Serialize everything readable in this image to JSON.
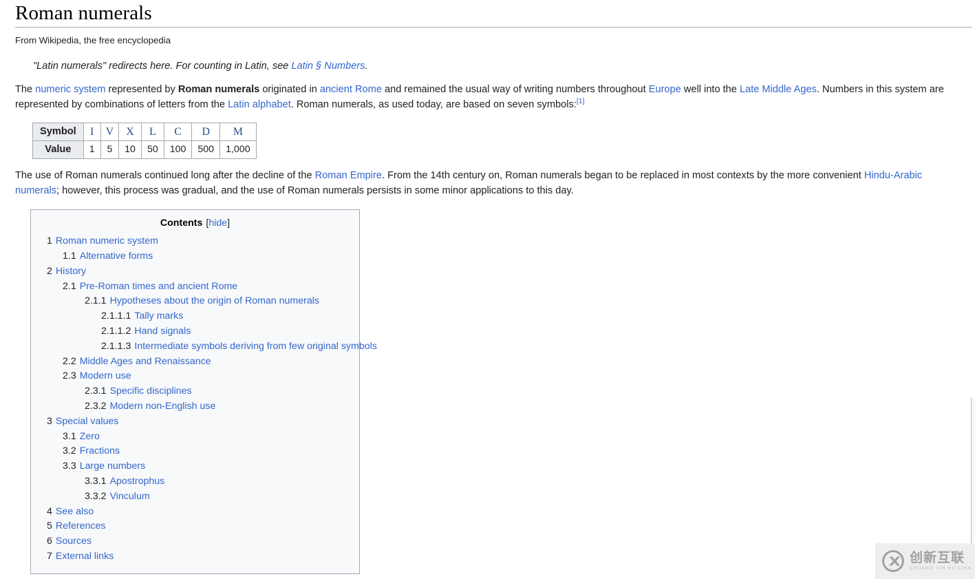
{
  "article": {
    "title": "Roman numerals",
    "tagline": "From Wikipedia, the free encyclopedia",
    "hatnote": {
      "before": "\"Latin numerals\" redirects here. For counting in Latin, see ",
      "link": "Latin § Numbers",
      "after": "."
    },
    "paragraph1": {
      "t1": "The ",
      "l1": "numeric system",
      "t2": " represented by ",
      "b1": "Roman numerals",
      "t3": " originated in ",
      "l2": "ancient Rome",
      "t4": " and remained the usual way of writing numbers throughout ",
      "l3": "Europe",
      "t5": " well into the ",
      "l4": "Late Middle Ages",
      "t6": ". Numbers in this system are represented by combinations of letters from the ",
      "l5": "Latin alphabet",
      "t7": ". Roman numerals, as used today, are based on seven symbols:",
      "ref": "[1]"
    },
    "paragraph2": {
      "t1": "The use of Roman numerals continued long after the decline of the ",
      "l1": "Roman Empire",
      "t2": ". From the 14th century on, Roman numerals began to be replaced in most contexts by the more convenient ",
      "l2": "Hindu-Arabic numerals",
      "t3": "; however, this process was gradual, and the use of Roman numerals persists in some minor applications to this day."
    }
  },
  "symbol_table": {
    "row_headers": [
      "Symbol",
      "Value"
    ],
    "symbols": [
      "I",
      "V",
      "X",
      "L",
      "C",
      "D",
      "M"
    ],
    "values": [
      "1",
      "5",
      "10",
      "50",
      "100",
      "500",
      "1,000"
    ]
  },
  "toc": {
    "title": "Contents",
    "toggle_open": "[",
    "toggle_label": "hide",
    "toggle_close": "]",
    "items": [
      {
        "number": "1",
        "text": "Roman numeric system",
        "level": 1
      },
      {
        "number": "1.1",
        "text": "Alternative forms",
        "level": 2
      },
      {
        "number": "2",
        "text": "History",
        "level": 1
      },
      {
        "number": "2.1",
        "text": "Pre-Roman times and ancient Rome",
        "level": 2
      },
      {
        "number": "2.1.1",
        "text": "Hypotheses about the origin of Roman numerals",
        "level": 3
      },
      {
        "number": "2.1.1.1",
        "text": "Tally marks",
        "level": 4
      },
      {
        "number": "2.1.1.2",
        "text": "Hand signals",
        "level": 4
      },
      {
        "number": "2.1.1.3",
        "text": "Intermediate symbols deriving from few original symbols",
        "level": 4
      },
      {
        "number": "2.2",
        "text": "Middle Ages and Renaissance",
        "level": 2
      },
      {
        "number": "2.3",
        "text": "Modern use",
        "level": 2
      },
      {
        "number": "2.3.1",
        "text": "Specific disciplines",
        "level": 3
      },
      {
        "number": "2.3.2",
        "text": "Modern non-English use",
        "level": 3
      },
      {
        "number": "3",
        "text": "Special values",
        "level": 1
      },
      {
        "number": "3.1",
        "text": "Zero",
        "level": 2
      },
      {
        "number": "3.2",
        "text": "Fractions",
        "level": 2
      },
      {
        "number": "3.3",
        "text": "Large numbers",
        "level": 2
      },
      {
        "number": "3.3.1",
        "text": "Apostrophus",
        "level": 3
      },
      {
        "number": "3.3.2",
        "text": "Vinculum",
        "level": 3
      },
      {
        "number": "4",
        "text": "See also",
        "level": 1
      },
      {
        "number": "5",
        "text": "References",
        "level": 1
      },
      {
        "number": "6",
        "text": "Sources",
        "level": 1
      },
      {
        "number": "7",
        "text": "External links",
        "level": 1
      }
    ]
  },
  "watermark": {
    "chinese": "创新互联",
    "pinyin": "CHUANG XIN HU LIAN"
  },
  "colors": {
    "link": "#3366cc",
    "border": "#a2a9b1",
    "toc_background": "#f8f9fa",
    "table_header": "#eaecf0",
    "symbol": "#2a4b8d",
    "text": "#202122"
  }
}
